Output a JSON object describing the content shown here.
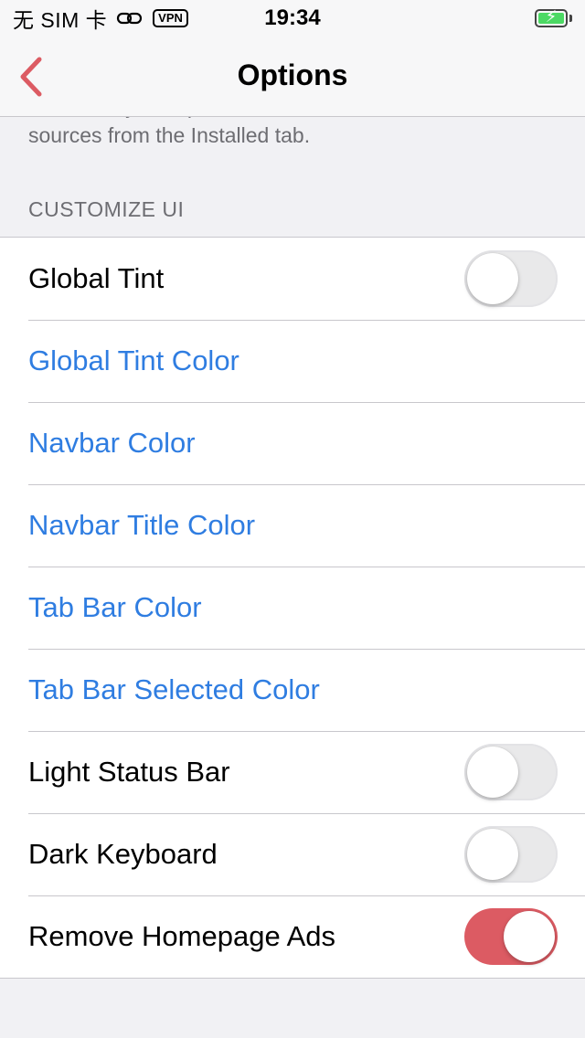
{
  "status_bar": {
    "carrier": "无 SIM 卡",
    "vpn": "VPN",
    "time": "19:34",
    "icons": [
      "link-icon",
      "battery-charging-icon"
    ]
  },
  "nav": {
    "title": "Options",
    "back_icon": "chevron-left-icon"
  },
  "footer_note": "Adds ability to export a list of installed tweaks and sources from the Installed tab.",
  "section": {
    "header": "CUSTOMIZE UI",
    "rows": [
      {
        "label": "Global Tint",
        "type": "toggle",
        "on": false
      },
      {
        "label": "Global Tint Color",
        "type": "link"
      },
      {
        "label": "Navbar Color",
        "type": "link"
      },
      {
        "label": "Navbar Title Color",
        "type": "link"
      },
      {
        "label": "Tab Bar Color",
        "type": "link"
      },
      {
        "label": "Tab Bar Selected Color",
        "type": "link"
      },
      {
        "label": "Light Status Bar",
        "type": "toggle",
        "on": false
      },
      {
        "label": "Dark Keyboard",
        "type": "toggle",
        "on": false
      },
      {
        "label": "Remove Homepage Ads",
        "type": "toggle",
        "on": true
      }
    ]
  },
  "colors": {
    "accent_link": "#2f7de1",
    "accent_tint": "#dc5b63",
    "background": "#f1f1f4"
  }
}
